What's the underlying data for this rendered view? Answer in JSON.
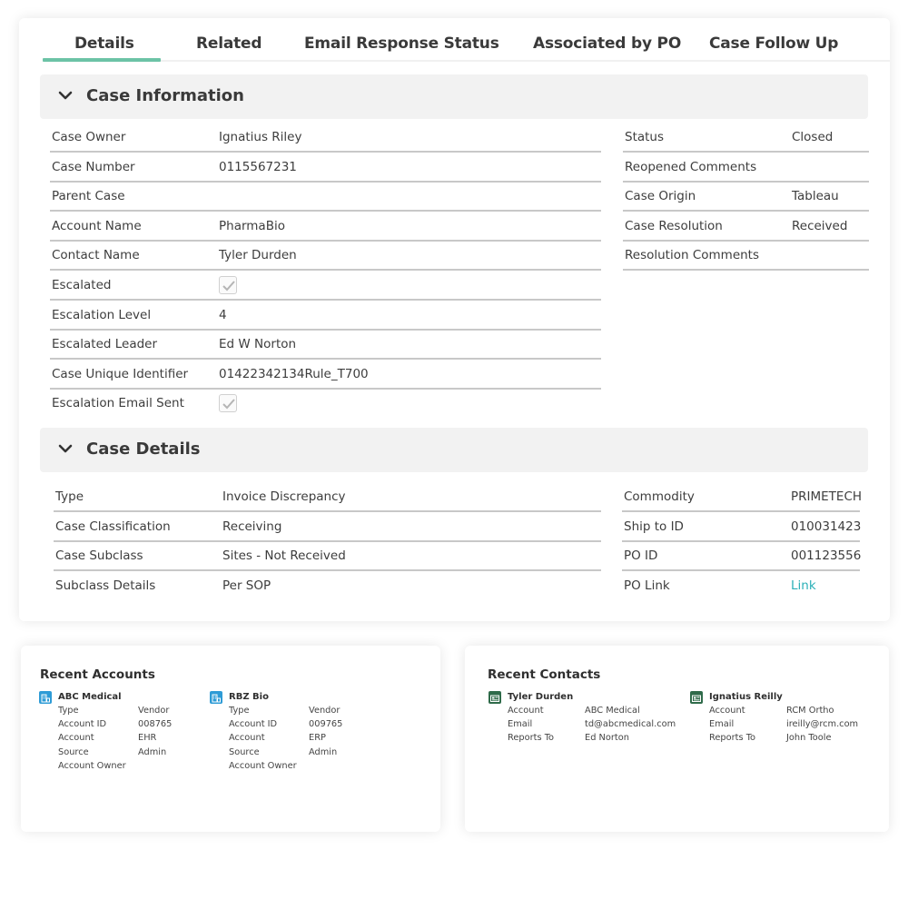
{
  "tabs": [
    {
      "label": "Details",
      "active": true
    },
    {
      "label": "Related",
      "active": false
    },
    {
      "label": "Email Response Status",
      "active": false
    },
    {
      "label": "Associated by PO",
      "active": false
    },
    {
      "label": "Case Follow Up",
      "active": false
    }
  ],
  "accent_color": "#6cc3a6",
  "link_color": "#2bb0b8",
  "case_information": {
    "title": "Case Information",
    "left_fields": [
      {
        "label": "Case Owner",
        "value": "Ignatius Riley"
      },
      {
        "label": "Case Number",
        "value": "0115567231"
      },
      {
        "label": "Parent Case",
        "value": ""
      },
      {
        "label": "Account Name",
        "value": "PharmaBio"
      },
      {
        "label": "Contact Name",
        "value": "Tyler Durden"
      },
      {
        "label": "Escalated",
        "value": "",
        "checkbox": true,
        "checked": true
      },
      {
        "label": "Escalation Level",
        "value": "4"
      },
      {
        "label": "Escalated Leader",
        "value": "Ed W Norton"
      },
      {
        "label": "Case Unique Identifier",
        "value": "01422342134Rule_T700"
      },
      {
        "label": "Escalation Email Sent",
        "value": "",
        "checkbox": true,
        "checked": true
      }
    ],
    "right_fields": [
      {
        "label": "Status",
        "value": "Closed"
      },
      {
        "label": "Reopened Comments",
        "value": ""
      },
      {
        "label": "Case Origin",
        "value": "Tableau"
      },
      {
        "label": "Case Resolution",
        "value": "Received"
      },
      {
        "label": "Resolution Comments",
        "value": ""
      }
    ]
  },
  "case_details": {
    "title": "Case Details",
    "left_fields": [
      {
        "label": "Type",
        "value": "Invoice Discrepancy"
      },
      {
        "label": "Case Classification",
        "value": "Receiving"
      },
      {
        "label": "Case Subclass",
        "value": "Sites - Not Received"
      },
      {
        "label": "Subclass Details",
        "value": "Per SOP"
      }
    ],
    "right_fields": [
      {
        "label": "Commodity",
        "value": "PRIMETECH"
      },
      {
        "label": "Ship to ID",
        "value": "010031423"
      },
      {
        "label": "PO ID",
        "value": "001123556"
      },
      {
        "label": "PO Link",
        "value": "Link"
      }
    ]
  },
  "recent_accounts": {
    "title": "Recent Accounts",
    "icon": "account-building-icon",
    "icon_color": "#2e9bd6",
    "items": [
      {
        "name": "ABC Medical",
        "rows": [
          {
            "key": "Type",
            "value": "Vendor"
          },
          {
            "key": "Account ID",
            "value": "008765"
          },
          {
            "key": "Account",
            "value": "EHR"
          },
          {
            "key": "Source",
            "value": "Admin"
          },
          {
            "key": "Account Owner",
            "value": ""
          }
        ]
      },
      {
        "name": "RBZ Bio",
        "rows": [
          {
            "key": "Type",
            "value": "Vendor"
          },
          {
            "key": "Account ID",
            "value": "009765"
          },
          {
            "key": "Account",
            "value": "ERP"
          },
          {
            "key": "Source",
            "value": "Admin"
          },
          {
            "key": "Account Owner",
            "value": ""
          }
        ]
      }
    ]
  },
  "recent_contacts": {
    "title": "Recent Contacts",
    "icon": "contact-card-icon",
    "icon_color": "#2f6b4a",
    "items": [
      {
        "name": "Tyler Durden",
        "rows": [
          {
            "key": "Account",
            "value": "ABC Medical"
          },
          {
            "key": "Email",
            "value": "td@abcmedical.com"
          },
          {
            "key": "Reports To",
            "value": "Ed Norton"
          }
        ]
      },
      {
        "name": "Ignatius Reilly",
        "rows": [
          {
            "key": "Account",
            "value": "RCM Ortho"
          },
          {
            "key": "Email",
            "value": "ireilly@rcm.com"
          },
          {
            "key": "Reports To",
            "value": "John Toole"
          }
        ]
      }
    ]
  }
}
